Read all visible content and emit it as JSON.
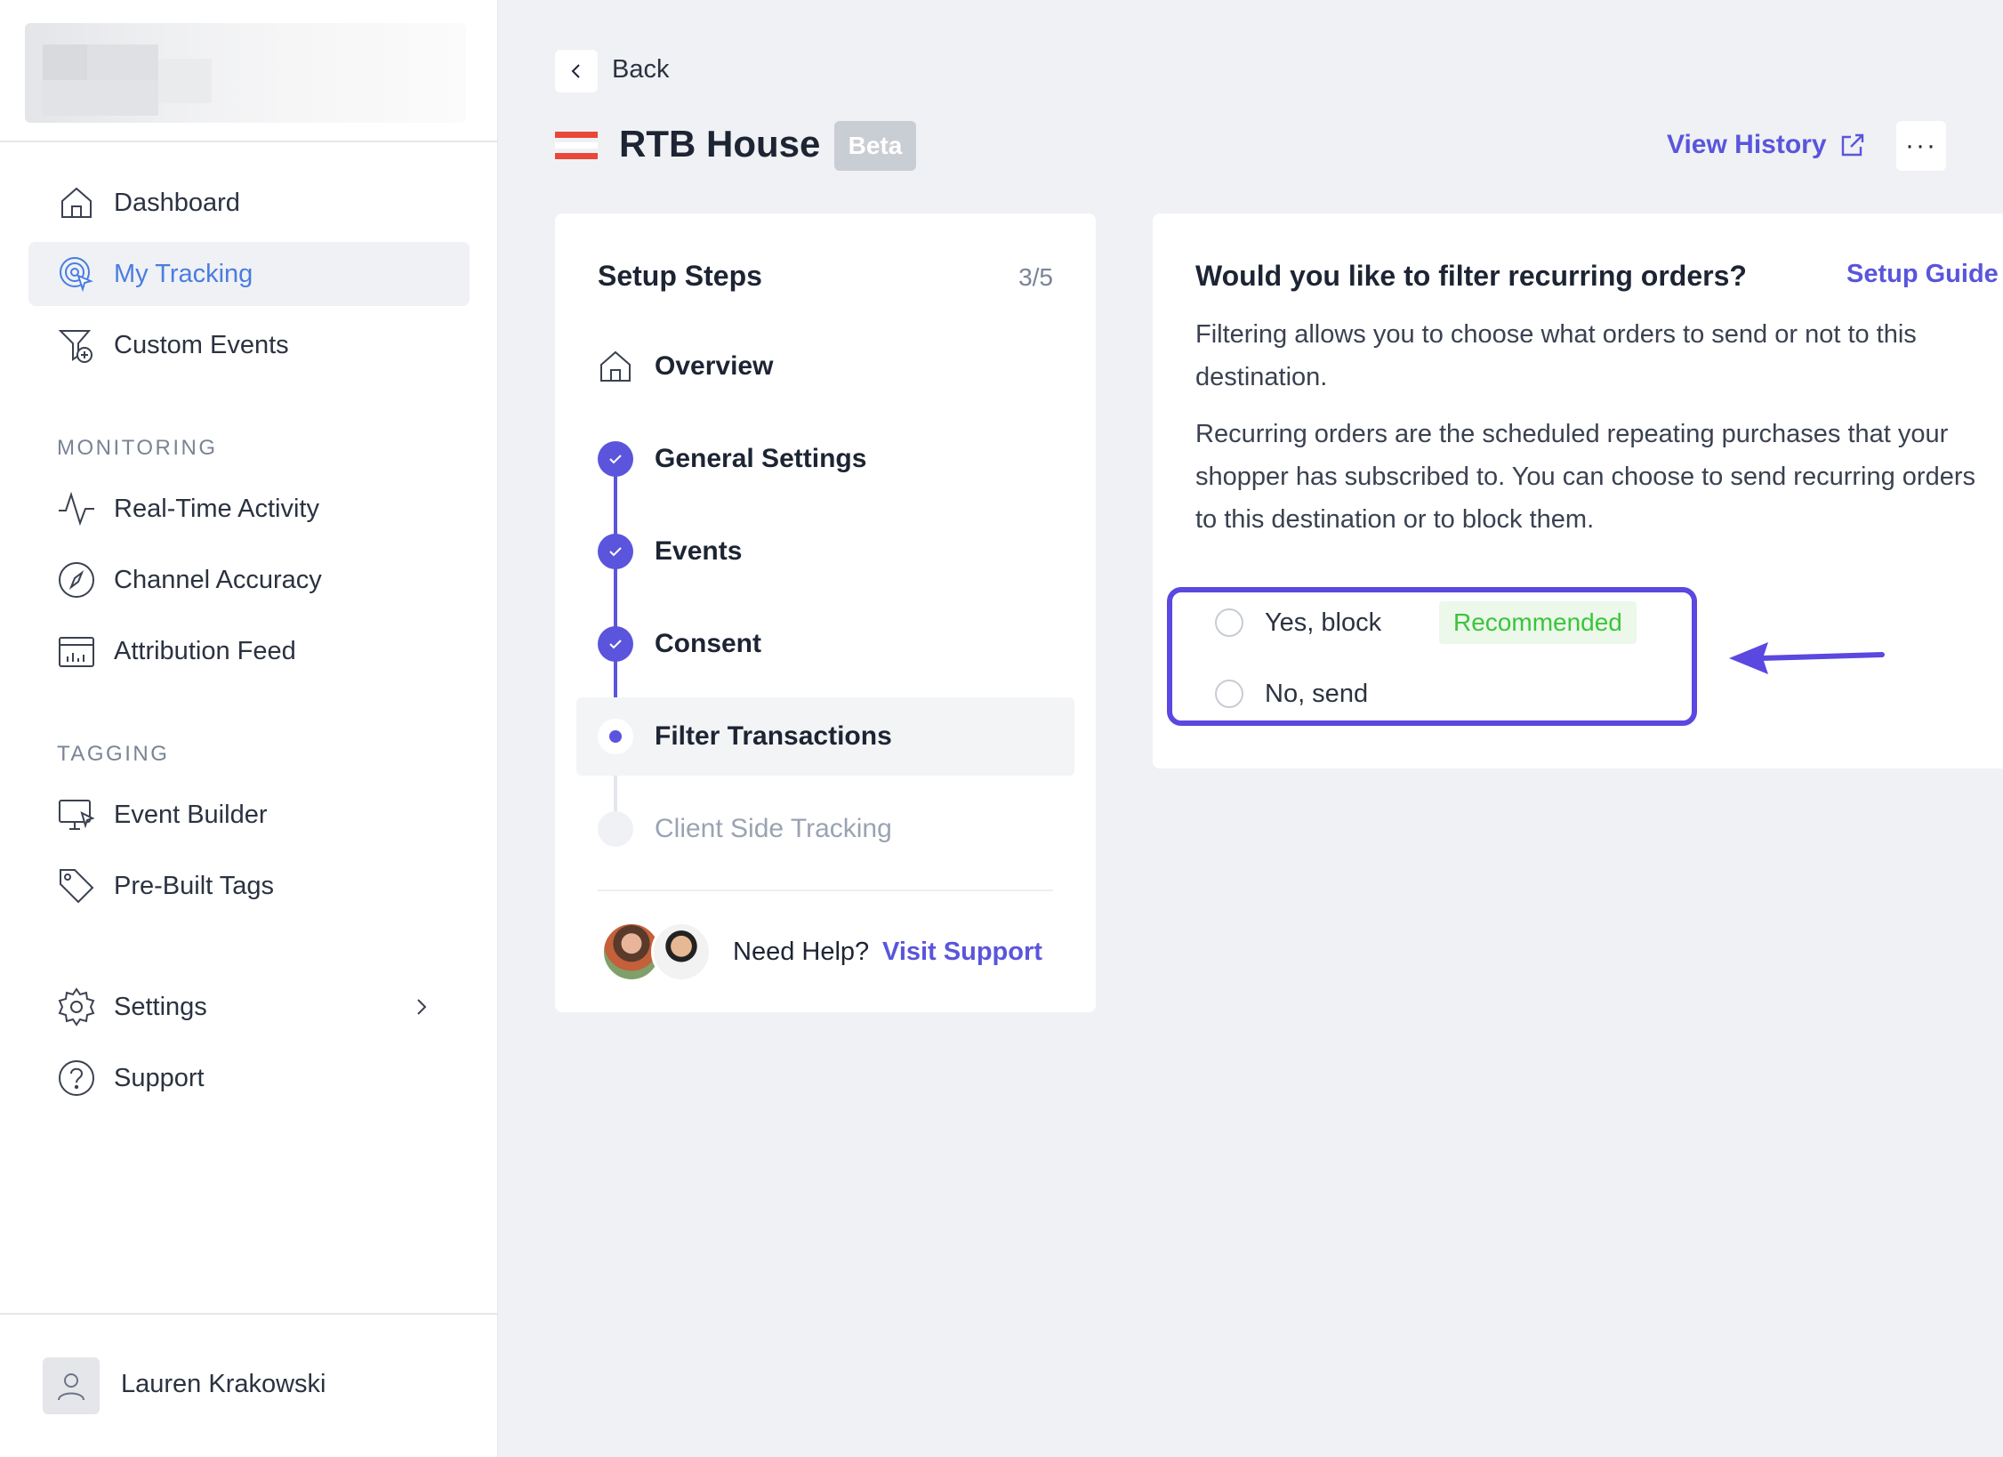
{
  "sidebar": {
    "items": [
      {
        "label": "Dashboard",
        "icon": "home-icon"
      },
      {
        "label": "My Tracking",
        "icon": "tracking-target-icon",
        "active": true
      },
      {
        "label": "Custom Events",
        "icon": "filter-plus-icon"
      }
    ],
    "monitoring_heading": "MONITORING",
    "monitoring": [
      {
        "label": "Real-Time Activity",
        "icon": "activity-icon"
      },
      {
        "label": "Channel Accuracy",
        "icon": "compass-icon"
      },
      {
        "label": "Attribution Feed",
        "icon": "calendar-chart-icon"
      }
    ],
    "tagging_heading": "TAGGING",
    "tagging": [
      {
        "label": "Event Builder",
        "icon": "monitor-cursor-icon"
      },
      {
        "label": "Pre-Built Tags",
        "icon": "tag-icon"
      }
    ],
    "settings": {
      "label": "Settings",
      "icon": "gear-icon"
    },
    "support": {
      "label": "Support",
      "icon": "help-circle-icon"
    },
    "user": {
      "name": "Lauren Krakowski"
    }
  },
  "header": {
    "back_label": "Back",
    "title": "RTB House",
    "badge": "Beta",
    "view_history": "View History",
    "more": "···",
    "brand_color": "#e8473a"
  },
  "steps": {
    "title": "Setup Steps",
    "count": "3/5",
    "items": [
      {
        "label": "Overview",
        "state": "overview"
      },
      {
        "label": "General Settings",
        "state": "done"
      },
      {
        "label": "Events",
        "state": "done"
      },
      {
        "label": "Consent",
        "state": "done"
      },
      {
        "label": "Filter Transactions",
        "state": "current"
      },
      {
        "label": "Client Side Tracking",
        "state": "pending"
      }
    ],
    "help_text": "Need Help?",
    "help_link": "Visit Support"
  },
  "filter": {
    "title": "Would you like to filter recurring orders?",
    "guide_link": "Setup Guide",
    "desc1_lines": [
      "Filtering allows you to choose what orders to send or not to this",
      "destination."
    ],
    "desc2_lines": [
      "Recurring orders are the scheduled repeating purchases that your",
      "shopper has subscribed to. You can choose to send recurring orders",
      "to this destination or to block them."
    ],
    "options": [
      {
        "label": "Yes, block",
        "badge": "Recommended"
      },
      {
        "label": "No, send"
      }
    ]
  },
  "colors": {
    "accent": "#5a55dc",
    "highlight_box": "#5a48e0",
    "recommended_text": "#3cc43c",
    "recommended_bg": "#ebf8ea"
  }
}
